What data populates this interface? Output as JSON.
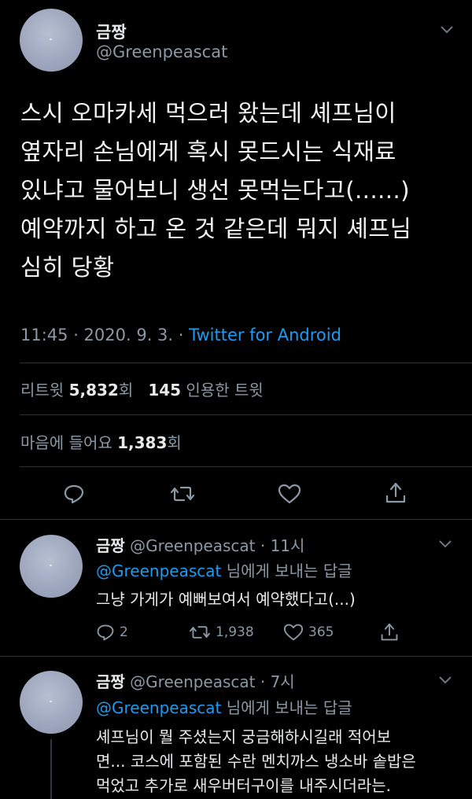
{
  "tweet": {
    "display_name": "금짱",
    "handle": "@Greenpeascat",
    "text_lines": [
      "스시 오마카세 먹으러 왔는데 셰프님이",
      "옆자리 손님에게 혹시 못드시는 식재료",
      "있냐고 물어보니 생선 못먹는다고(......)",
      "예약까지 하고 온 것 같은데 뭐지 셰프님",
      "심히 당황"
    ],
    "time": "11:45 · 2020. 9. 3. · ",
    "source": "Twitter for Android",
    "retweets_label": "리트윗",
    "retweets_count": "5,832",
    "retweets_unit": "회",
    "quotes_count": "145",
    "quotes_label": "인용한 트윗",
    "likes_label": "마음에 들어요",
    "likes_count": "1,383",
    "likes_unit": "회"
  },
  "replies": [
    {
      "display_name": "금짱",
      "handle_time": "@Greenpeascat · 11시",
      "reply_to_handle": "@Greenpeascat",
      "reply_to_suffix": " 님에게 보내는 답글",
      "text_lines": [
        "그냥 가게가 예뻐보여서 예약했다고(...)"
      ],
      "reply_count": "2",
      "retweet_count": "1,938",
      "like_count": "365"
    },
    {
      "display_name": "금짱",
      "handle_time": "@Greenpeascat · 7시",
      "reply_to_handle": "@Greenpeascat",
      "reply_to_suffix": " 님에게 보내는 답글",
      "text_lines": [
        "셰프님이 뭘 주셨는지 궁금해하시길래 적어보",
        "면... 코스에 포함된 수란 멘치까스 냉소바 솥밥은",
        "먹었고 추가로 새우버터구이를 내주시더라는."
      ]
    }
  ],
  "icons": {
    "reply": "reply-icon",
    "retweet": "retweet-icon",
    "like": "heart-icon",
    "share": "share-icon",
    "more": "chevron-down-icon"
  },
  "colors": {
    "background": "#000000",
    "link": "#1d9bf0",
    "muted": "#8b98a5",
    "divider": "#2f3336"
  }
}
